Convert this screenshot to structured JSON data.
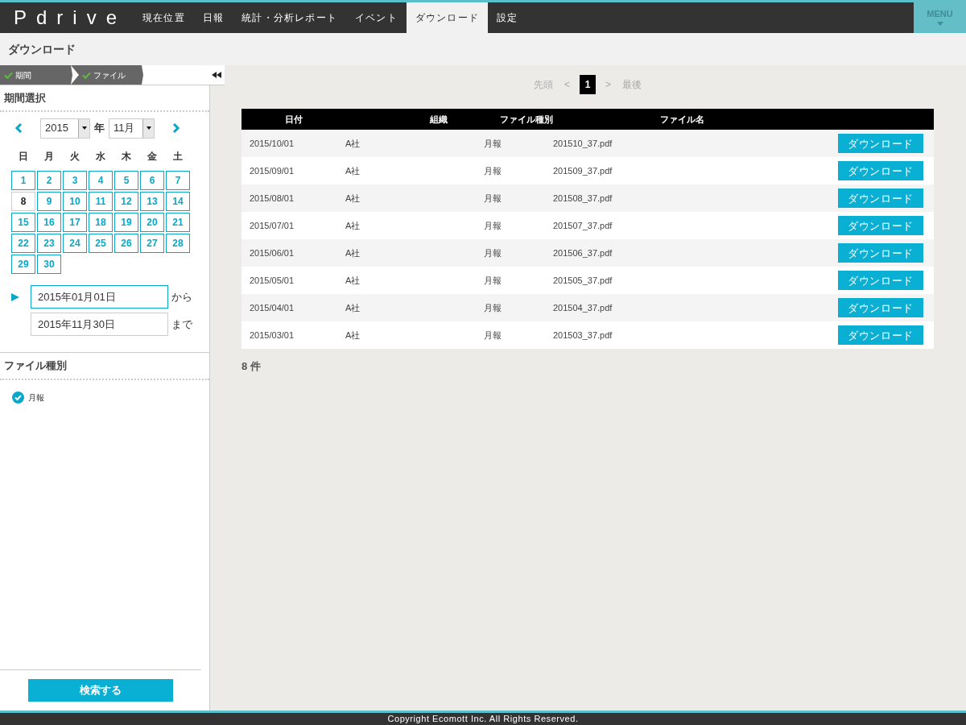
{
  "header": {
    "logo": "Pdrive",
    "nav": [
      {
        "label": "現在位置",
        "selected": false
      },
      {
        "label": "日報",
        "selected": false
      },
      {
        "label": "統計・分析レポート",
        "selected": false
      },
      {
        "label": "イベント",
        "selected": false
      },
      {
        "label": "ダウンロード",
        "selected": true
      },
      {
        "label": "設定",
        "selected": false
      }
    ],
    "menu": "MENU"
  },
  "page_title": "ダウンロード",
  "steps": [
    {
      "label": "期間",
      "done": true
    },
    {
      "label": "ファイル",
      "done": true
    }
  ],
  "sidebar": {
    "period": {
      "title": "期間選択",
      "year": "2015",
      "year_unit": "年",
      "month": "11月",
      "weekdays": [
        "日",
        "月",
        "火",
        "水",
        "木",
        "金",
        "土"
      ],
      "days": [
        {
          "label": "1",
          "today": false
        },
        {
          "label": "2",
          "today": false
        },
        {
          "label": "3",
          "today": false
        },
        {
          "label": "4",
          "today": false
        },
        {
          "label": "5",
          "today": false
        },
        {
          "label": "6",
          "today": false
        },
        {
          "label": "7",
          "today": false
        },
        {
          "label": "8",
          "today": true
        },
        {
          "label": "9",
          "today": false
        },
        {
          "label": "10",
          "today": false
        },
        {
          "label": "11",
          "today": false
        },
        {
          "label": "12",
          "today": false
        },
        {
          "label": "13",
          "today": false
        },
        {
          "label": "14",
          "today": false
        },
        {
          "label": "15",
          "today": false
        },
        {
          "label": "16",
          "today": false
        },
        {
          "label": "17",
          "today": false
        },
        {
          "label": "18",
          "today": false
        },
        {
          "label": "19",
          "today": false
        },
        {
          "label": "20",
          "today": false
        },
        {
          "label": "21",
          "today": false
        },
        {
          "label": "22",
          "today": false
        },
        {
          "label": "23",
          "today": false
        },
        {
          "label": "24",
          "today": false
        },
        {
          "label": "25",
          "today": false
        },
        {
          "label": "26",
          "today": false
        },
        {
          "label": "27",
          "today": false
        },
        {
          "label": "28",
          "today": false
        },
        {
          "label": "29",
          "today": false
        },
        {
          "label": "30",
          "today": false
        }
      ],
      "range": [
        {
          "value": "2015年01月01日",
          "suffix": "から",
          "selected": true
        },
        {
          "value": "2015年11月30日",
          "suffix": "まで",
          "selected": false
        }
      ]
    },
    "file_type": {
      "title": "ファイル種別",
      "options": [
        {
          "label": "月報",
          "checked": true
        }
      ]
    },
    "search_button": "検索する"
  },
  "pagination": {
    "first": "先頭",
    "prev": "<",
    "pages": [
      {
        "label": "1",
        "selected": true
      }
    ],
    "next": ">",
    "last": "最後"
  },
  "table": {
    "columns": [
      "日付",
      "組織",
      "ファイル種別",
      "ファイル名"
    ],
    "rows": [
      {
        "date": "2015/10/01",
        "org": "A社",
        "type": "月報",
        "file": "201510_37.pdf",
        "action": "ダウンロード"
      },
      {
        "date": "2015/09/01",
        "org": "A社",
        "type": "月報",
        "file": "201509_37.pdf",
        "action": "ダウンロード"
      },
      {
        "date": "2015/08/01",
        "org": "A社",
        "type": "月報",
        "file": "201508_37.pdf",
        "action": "ダウンロード"
      },
      {
        "date": "2015/07/01",
        "org": "A社",
        "type": "月報",
        "file": "201507_37.pdf",
        "action": "ダウンロード"
      },
      {
        "date": "2015/06/01",
        "org": "A社",
        "type": "月報",
        "file": "201506_37.pdf",
        "action": "ダウンロード"
      },
      {
        "date": "2015/05/01",
        "org": "A社",
        "type": "月報",
        "file": "201505_37.pdf",
        "action": "ダウンロード"
      },
      {
        "date": "2015/04/01",
        "org": "A社",
        "type": "月報",
        "file": "201504_37.pdf",
        "action": "ダウンロード"
      },
      {
        "date": "2015/03/01",
        "org": "A社",
        "type": "月報",
        "file": "201503_37.pdf",
        "action": "ダウンロード"
      }
    ]
  },
  "count": "8 件",
  "footer": "Copyright Ecomott Inc. All Rights Reserved."
}
